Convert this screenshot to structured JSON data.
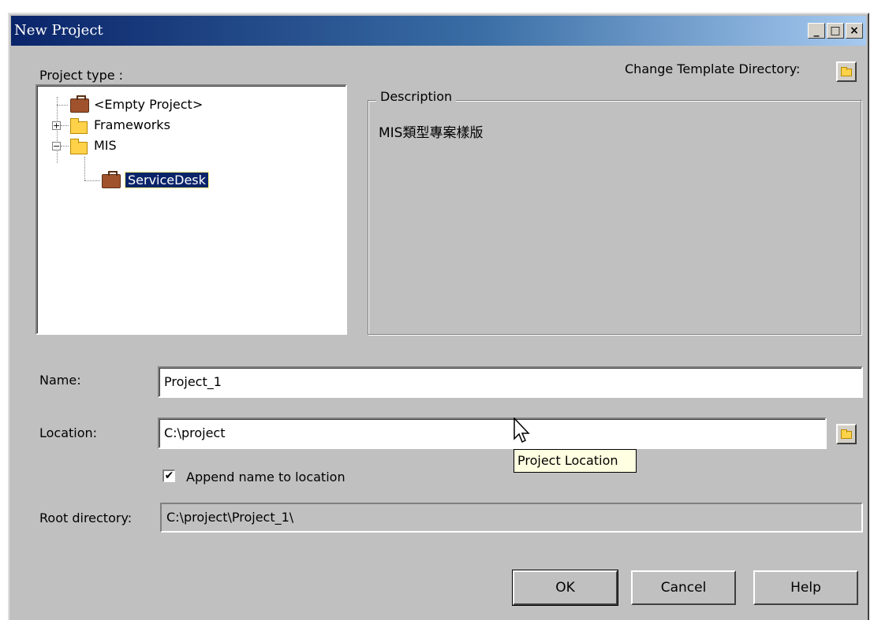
{
  "window": {
    "title": "New Project"
  },
  "titlebar_buttons": {
    "minimize": "_",
    "maximize": "□",
    "close": "×"
  },
  "labels": {
    "project_type": "Project type :",
    "change_template_dir": "Change Template Directory:",
    "description_legend": "Description",
    "name": "Name:",
    "location": "Location:",
    "root_directory": "Root directory:",
    "append_name": "Append name to location"
  },
  "tree": [
    {
      "label": "<Empty Project>",
      "icon": "briefcase-icon"
    },
    {
      "label": "Frameworks",
      "icon": "folder-icon",
      "expander": "+"
    },
    {
      "label": "MIS",
      "icon": "folder-icon",
      "expander": "−"
    },
    {
      "label": "ServiceDesk",
      "icon": "briefcase-icon",
      "selected": true
    }
  ],
  "description_text": "MIS類型專案樣版",
  "fields": {
    "name_value": "Project_1",
    "location_value": "C:\\project",
    "root_directory_value": "C:\\project\\Project_1\\"
  },
  "checkbox": {
    "checked": true,
    "mark": "✔"
  },
  "tooltip": "Project Location",
  "buttons": {
    "ok": "OK",
    "cancel": "Cancel",
    "help": "Help"
  },
  "colors": {
    "titlebar_start": "#0a246a",
    "titlebar_end": "#a6caf0",
    "face": "#c0c0c0",
    "selection": "#0a246a",
    "tooltip_bg": "#ffffe1"
  }
}
